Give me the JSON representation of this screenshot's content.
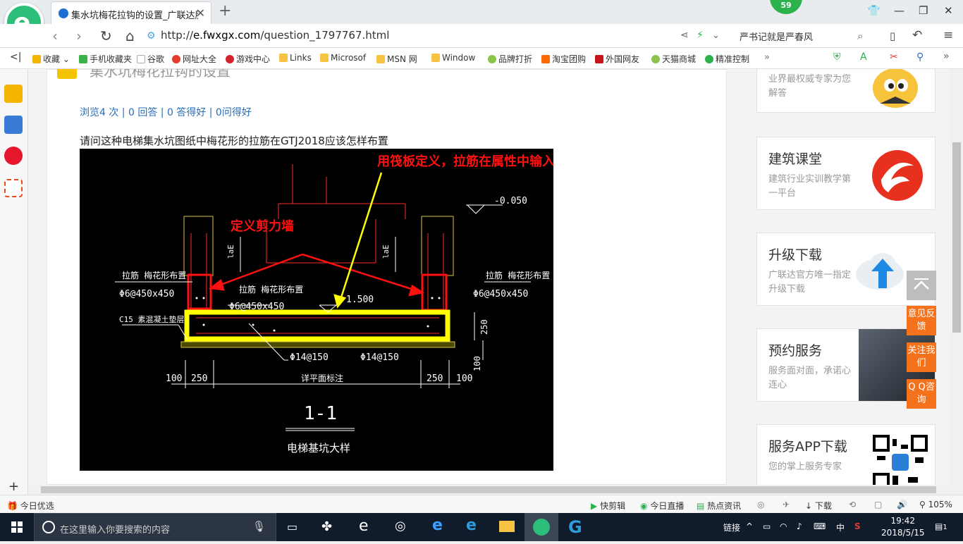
{
  "browser": {
    "tab_title": "集水坑梅花拉钩的设置_广联达服",
    "badge_count": "59",
    "url_prefix": "http://",
    "url_domain": "e.fwxgx.com",
    "url_path": "/question_1797767.html",
    "address_right_text": "严书记就是严春风"
  },
  "bookmarks": [
    {
      "label": "收藏",
      "color": "#f2b400"
    },
    {
      "label": "手机收藏夹",
      "color": "#3cb34a"
    },
    {
      "label": "谷歌",
      "color": "#ffffff"
    },
    {
      "label": "网址大全",
      "color": "#e23c2f"
    },
    {
      "label": "游戏中心",
      "color": "#d2232a"
    },
    {
      "label": "Links",
      "color": "#f6c343"
    },
    {
      "label": "Microsof",
      "color": "#f6c343"
    },
    {
      "label": "MSN 网",
      "color": "#f6c343"
    },
    {
      "label": "Window",
      "color": "#f6c343"
    },
    {
      "label": "品牌打折",
      "color": "#8bc34a"
    },
    {
      "label": "淘宝团购",
      "color": "#ff6a00"
    },
    {
      "label": "外国网友",
      "color": "#c4151c"
    },
    {
      "label": "天猫商城",
      "color": "#8bc34a"
    },
    {
      "label": "精准控制",
      "color": "#2bb24c"
    }
  ],
  "page": {
    "title_partial": "集水坑梅花拉钩的设置",
    "stats": "浏览4 次 | 0 回答 | 0 答得好 | 0问得好",
    "question": "请问这种电梯集水坑图纸中梅花形的拉筋在GTJ2018应该怎样布置"
  },
  "drawing": {
    "annot_top": "用筏板定义，拉筋在属性中输入",
    "annot_wall": "定义剪力墙",
    "elev_top": "-0.050",
    "elev_mid": "1.500",
    "left_label": "拉筋 梅花形布置",
    "left_spec": "Φ6@450x450",
    "right_label": "拉筋 梅花形布置",
    "right_spec": "Φ6@450x450",
    "mid_label": "拉筋 梅花形布置",
    "mid_spec": "Φ6@450x450",
    "c15": "C15 素混凝土垫层",
    "la_left": "laE",
    "la_right": "laE",
    "bar1": "Φ14@150",
    "bar2": "Φ14@150",
    "dim_250_side": "250",
    "dim_100_side": "100",
    "dim_100_l": "100",
    "dim_250_l": "250",
    "dim_center": "详平面标注",
    "dim_250_r": "250",
    "dim_100_r": "100",
    "section": "1-1",
    "caption": "电梯基坑大样"
  },
  "sidebar": {
    "cards": [
      {
        "heading": "",
        "sub": "业界最权威专家为您解答"
      },
      {
        "heading": "建筑课堂",
        "sub": "建筑行业实训教学第一平台"
      },
      {
        "heading": "升级下载",
        "sub": "广联达官方唯一指定升级下载"
      },
      {
        "heading": "预约服务",
        "sub": "服务面对面，承诺心连心"
      },
      {
        "heading": "服务APP下载",
        "sub": "您的掌上服务专家"
      }
    ],
    "float": {
      "feedback": "意见反馈",
      "follow": "关注我们",
      "qq": "Q Q咨询"
    }
  },
  "statusbar": {
    "left": "今日优选",
    "items": [
      "快剪辑",
      "今日直播",
      "热点资讯",
      "下载"
    ],
    "zoom": "105%"
  },
  "taskbar": {
    "search_placeholder": "在这里输入你要搜索的内容",
    "tray_link": "链接",
    "ime": "中",
    "time": "19:42",
    "date": "2018/5/15",
    "notif": "1"
  }
}
